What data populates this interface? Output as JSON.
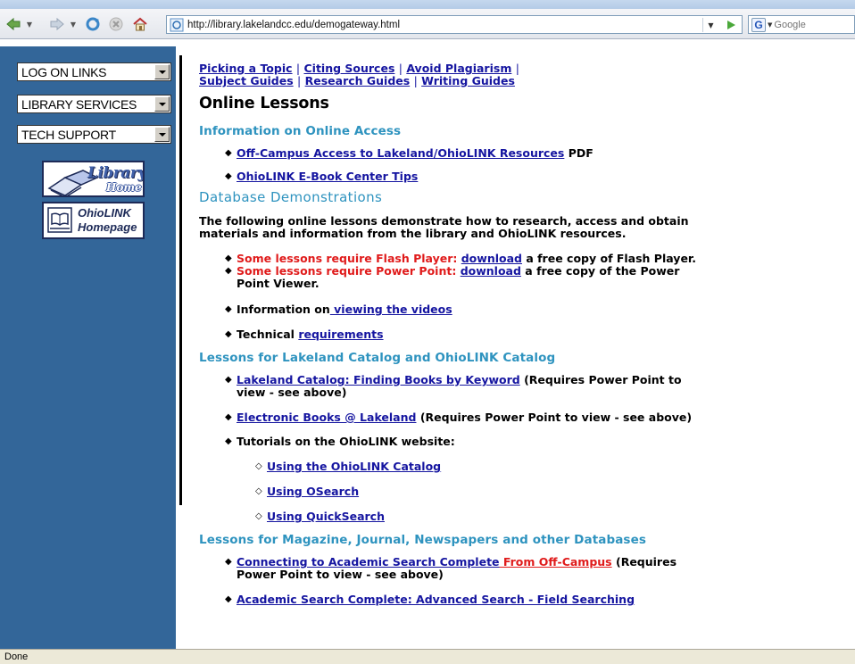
{
  "browser": {
    "url": "http://library.lakelandcc.edu/demogateway.html",
    "search_placeholder": "Google",
    "search_engine_letter": "G"
  },
  "sidebar": {
    "selects": [
      {
        "label": "LOG ON LINKS"
      },
      {
        "label": "LIBRARY SERVICES"
      },
      {
        "label": "TECH SUPPORT"
      }
    ],
    "library_logo": {
      "line1": "Library",
      "line2": "Home"
    },
    "ohiolink_logo": {
      "line1": "OhioLINK",
      "line2": "Homepage"
    }
  },
  "topnav": {
    "links": [
      "Picking a Topic",
      "Citing Sources",
      "Avoid Plagiarism",
      "Subject Guides",
      "Research Guides",
      "Writing Guides"
    ],
    "separator": "|"
  },
  "content": {
    "title": "Online Lessons",
    "access": {
      "heading": "Information on Online Access",
      "item1_link": "Off-Campus Access to Lakeland/OhioLINK Resources",
      "item1_suffix": " PDF",
      "item2_link": "OhioLINK E-Book Center Tips"
    },
    "demos": {
      "heading": "Database Demonstrations",
      "intro_line1": "The following online lessons demonstrate how to research, access and obtain",
      "intro_line2": "materials and information from the library and OhioLINK resources.",
      "flash_red": "Some lessons require Flash Player: ",
      "flash_link": "download",
      "flash_suffix": " a free copy of Flash Player.",
      "pp_red": "Some lessons require Power Point: ",
      "pp_link": "download",
      "pp_suffix_line1": " a free copy of the Power",
      "pp_suffix_line2": "Point Viewer.",
      "videos_prefix": "Information on",
      "videos_link": " viewing the videos",
      "tech_prefix": "Technical ",
      "tech_link": "requirements"
    },
    "catalog": {
      "heading": "Lessons for Lakeland Catalog and OhioLINK Catalog",
      "item1_link": "Lakeland Catalog: Finding Books by Keyword",
      "item1_suffix_line1": " (Requires Power Point to",
      "item1_suffix_line2": "view - see above)",
      "item2_link": "Electronic Books @ Lakeland",
      "item2_suffix": " (Requires Power Point to view - see above)",
      "item3": "Tutorials on the OhioLINK website:",
      "sub1": "Using the OhioLINK Catalog",
      "sub2": "Using OSearch",
      "sub3": "Using QuickSearch"
    },
    "magazines": {
      "heading": "Lessons for Magazine, Journal, Newspapers and other Databases",
      "item1_link": "Connecting to Academic Search Complete",
      "item1_red_link": " From Off-Campus",
      "item1_suffix_line1": " (Requires",
      "item1_suffix_line2": "Power Point to view - see above)",
      "item2_link": "Academic Search Complete: Advanced Search - Field Searching"
    }
  },
  "status": {
    "text": "Done"
  }
}
